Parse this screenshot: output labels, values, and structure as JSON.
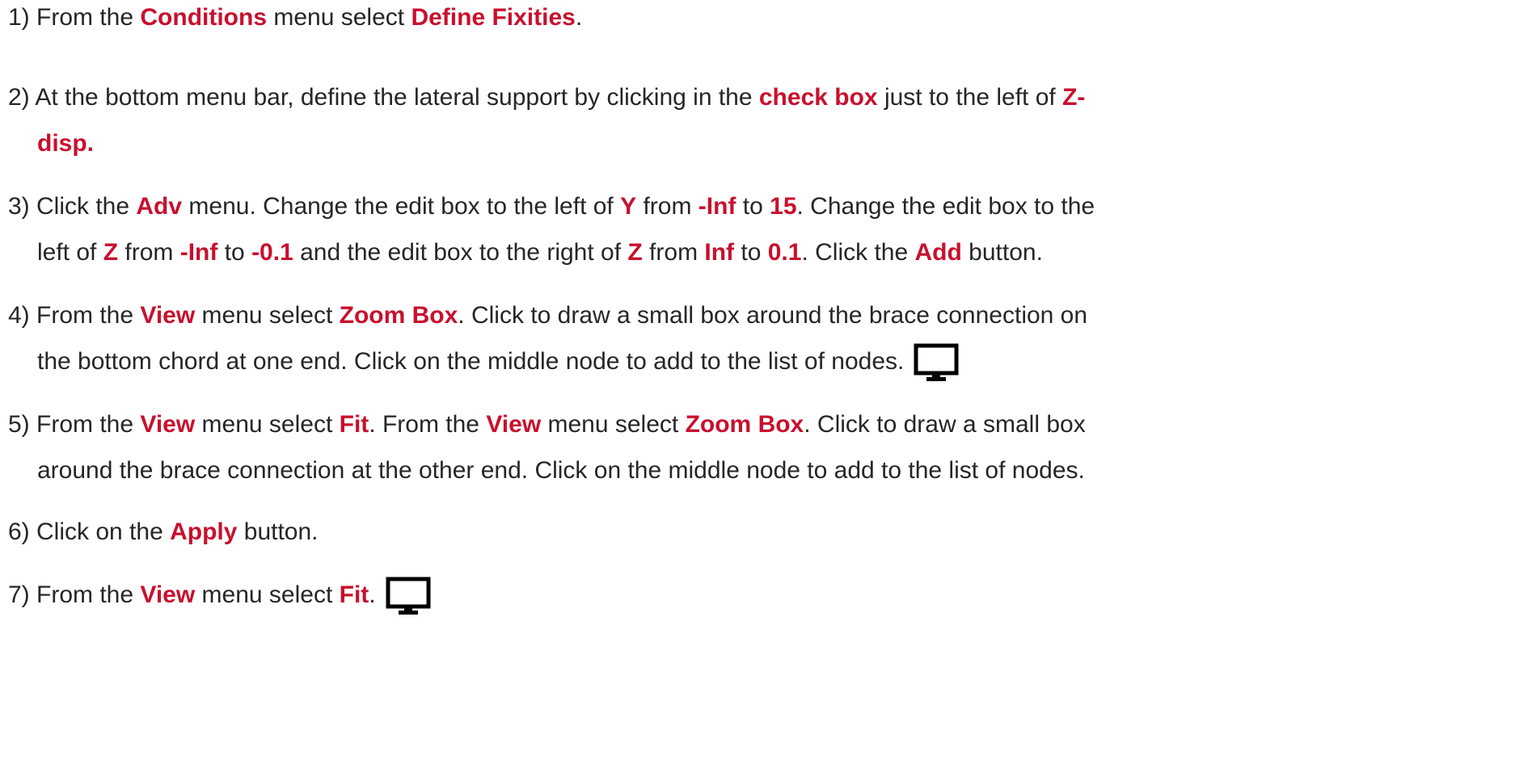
{
  "steps": [
    {
      "lines": [
        [
          {
            "t": "1) From the "
          },
          {
            "t": "Conditions",
            "hl": true
          },
          {
            "t": " menu select "
          },
          {
            "t": "Define Fixities",
            "hl": true
          },
          {
            "t": "."
          }
        ]
      ]
    },
    {
      "lines": [
        [
          {
            "t": "2) At the bottom menu bar, define the lateral support by clicking in the "
          },
          {
            "t": "check box",
            "hl": true
          },
          {
            "t": " just to the left of "
          },
          {
            "t": "Z-",
            "hl": true
          }
        ],
        [
          {
            "t": "disp.",
            "hl": true
          }
        ]
      ]
    },
    {
      "lines": [
        [
          {
            "t": "3) Click the "
          },
          {
            "t": "Adv",
            "hl": true
          },
          {
            "t": " menu. Change the edit box to the left of "
          },
          {
            "t": "Y",
            "hl": true
          },
          {
            "t": " from "
          },
          {
            "t": "-Inf",
            "hl": true
          },
          {
            "t": " to "
          },
          {
            "t": "15",
            "hl": true
          },
          {
            "t": ". Change the edit box to the"
          }
        ],
        [
          {
            "t": "left of "
          },
          {
            "t": "Z",
            "hl": true
          },
          {
            "t": " from "
          },
          {
            "t": "-Inf",
            "hl": true
          },
          {
            "t": " to "
          },
          {
            "t": "-0.1",
            "hl": true
          },
          {
            "t": " and the edit box to the right of "
          },
          {
            "t": "Z",
            "hl": true
          },
          {
            "t": " from "
          },
          {
            "t": "Inf",
            "hl": true
          },
          {
            "t": " to "
          },
          {
            "t": "0.1",
            "hl": true
          },
          {
            "t": ". Click the "
          },
          {
            "t": "Add",
            "hl": true
          },
          {
            "t": " button."
          }
        ]
      ]
    },
    {
      "lines": [
        [
          {
            "t": "4) From the "
          },
          {
            "t": "View",
            "hl": true
          },
          {
            "t": " menu select "
          },
          {
            "t": "Zoom Box",
            "hl": true
          },
          {
            "t": ". Click to draw a small box around the brace connection on"
          }
        ],
        [
          {
            "t": "the bottom chord at one end. Click on the middle node to add to the list of nodes."
          }
        ]
      ],
      "icon": "monitor-icon"
    },
    {
      "lines": [
        [
          {
            "t": "5) From the "
          },
          {
            "t": "View",
            "hl": true
          },
          {
            "t": " menu select "
          },
          {
            "t": "Fit",
            "hl": true
          },
          {
            "t": ". From the "
          },
          {
            "t": "View",
            "hl": true
          },
          {
            "t": " menu select "
          },
          {
            "t": "Zoom Box",
            "hl": true
          },
          {
            "t": ". Click to draw a small box"
          }
        ],
        [
          {
            "t": "around the brace connection at the other end. Click on the middle node to add to the list of nodes."
          }
        ]
      ]
    },
    {
      "lines": [
        [
          {
            "t": "6) Click on the "
          },
          {
            "t": "Apply",
            "hl": true
          },
          {
            "t": " button."
          }
        ]
      ]
    },
    {
      "lines": [
        [
          {
            "t": "7) From the "
          },
          {
            "t": "View",
            "hl": true
          },
          {
            "t": " menu select "
          },
          {
            "t": "Fit",
            "hl": true
          },
          {
            "t": "."
          }
        ]
      ],
      "icon": "monitor-icon"
    }
  ],
  "colors": {
    "text": "#262626",
    "highlight": "#c8102e"
  }
}
